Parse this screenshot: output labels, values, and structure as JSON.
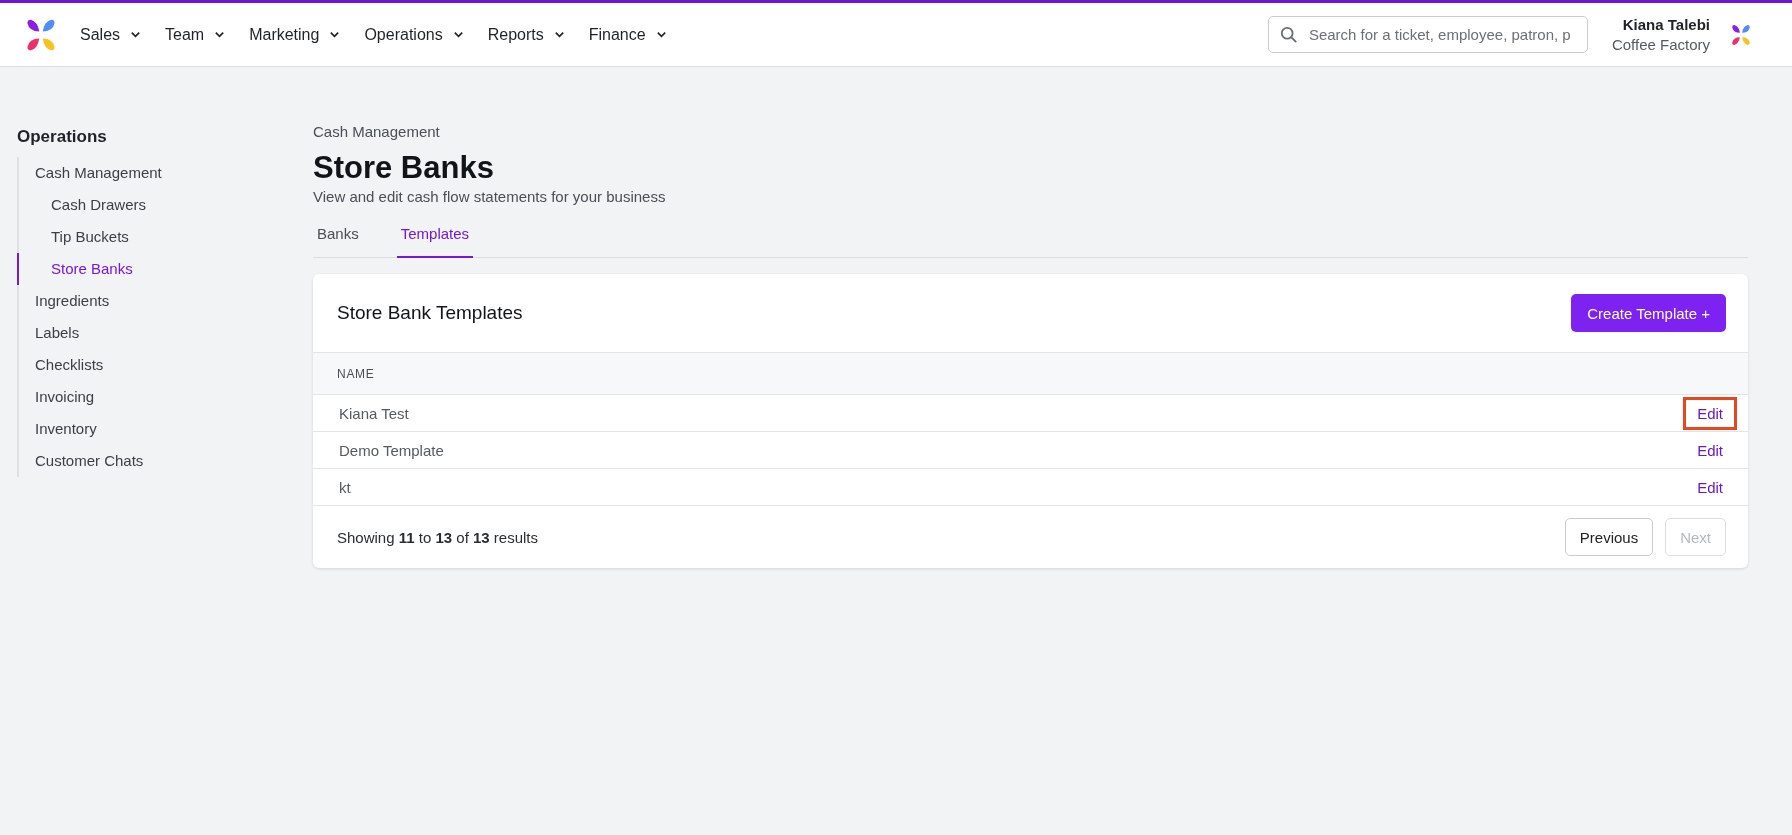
{
  "topbar": {
    "nav": [
      {
        "label": "Sales"
      },
      {
        "label": "Team"
      },
      {
        "label": "Marketing"
      },
      {
        "label": "Operations"
      },
      {
        "label": "Reports"
      },
      {
        "label": "Finance"
      }
    ],
    "search": {
      "placeholder": "Search for a ticket, employee, patron, p"
    },
    "user": {
      "name": "Kiana Talebi",
      "company": "Coffee Factory"
    }
  },
  "sidebar": {
    "title": "Operations",
    "items": [
      {
        "label": "Cash Management",
        "selected": false,
        "children": [
          {
            "label": "Cash Drawers",
            "selected": false
          },
          {
            "label": "Tip Buckets",
            "selected": false
          },
          {
            "label": "Store Banks",
            "selected": true
          }
        ]
      },
      {
        "label": "Ingredients",
        "selected": false
      },
      {
        "label": "Labels",
        "selected": false
      },
      {
        "label": "Checklists",
        "selected": false
      },
      {
        "label": "Invoicing",
        "selected": false
      },
      {
        "label": "Inventory",
        "selected": false
      },
      {
        "label": "Customer Chats",
        "selected": false
      }
    ]
  },
  "page": {
    "breadcrumb": "Cash Management",
    "title": "Store Banks",
    "subtitle": "View and edit cash flow statements for your business",
    "tabs": [
      {
        "label": "Banks",
        "selected": false
      },
      {
        "label": "Templates",
        "selected": true
      }
    ]
  },
  "card": {
    "title": "Store Bank Templates",
    "create_button": "Create Template +",
    "table": {
      "columns": [
        "NAME"
      ],
      "rows": [
        {
          "name": "Kiana Test",
          "action": "Edit",
          "highlighted": true
        },
        {
          "name": "Demo Template",
          "action": "Edit",
          "highlighted": false
        },
        {
          "name": "kt",
          "action": "Edit",
          "highlighted": false
        }
      ]
    },
    "footer": {
      "summary": "Showing **11** to **13** of **13** results",
      "previous": {
        "label": "Previous",
        "disabled": false
      },
      "next": {
        "label": "Next",
        "disabled": true
      }
    }
  }
}
